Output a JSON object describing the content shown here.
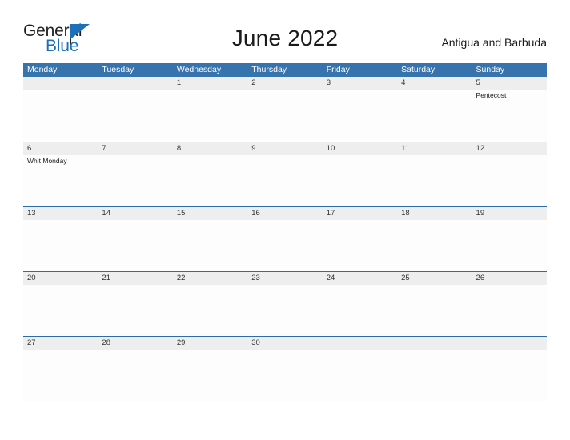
{
  "logo": {
    "word_one": "General",
    "word_two": "Blue",
    "triangle_icon": "triangle-right-icon",
    "accent_color": "#1d70b8"
  },
  "header": {
    "title": "June 2022",
    "region": "Antigua and Barbuda"
  },
  "calendar": {
    "header_color": "#3773ad",
    "band_color": "#eeeeee",
    "weekdays": [
      "Monday",
      "Tuesday",
      "Wednesday",
      "Thursday",
      "Friday",
      "Saturday",
      "Sunday"
    ],
    "weeks": [
      {
        "days": [
          {
            "num": "",
            "events": []
          },
          {
            "num": "",
            "events": []
          },
          {
            "num": "1",
            "events": []
          },
          {
            "num": "2",
            "events": []
          },
          {
            "num": "3",
            "events": []
          },
          {
            "num": "4",
            "events": []
          },
          {
            "num": "5",
            "events": [
              "Pentecost"
            ]
          }
        ]
      },
      {
        "days": [
          {
            "num": "6",
            "events": [
              "Whit Monday"
            ]
          },
          {
            "num": "7",
            "events": []
          },
          {
            "num": "8",
            "events": []
          },
          {
            "num": "9",
            "events": []
          },
          {
            "num": "10",
            "events": []
          },
          {
            "num": "11",
            "events": []
          },
          {
            "num": "12",
            "events": []
          }
        ]
      },
      {
        "days": [
          {
            "num": "13",
            "events": []
          },
          {
            "num": "14",
            "events": []
          },
          {
            "num": "15",
            "events": []
          },
          {
            "num": "16",
            "events": []
          },
          {
            "num": "17",
            "events": []
          },
          {
            "num": "18",
            "events": []
          },
          {
            "num": "19",
            "events": []
          }
        ]
      },
      {
        "days": [
          {
            "num": "20",
            "events": []
          },
          {
            "num": "21",
            "events": []
          },
          {
            "num": "22",
            "events": []
          },
          {
            "num": "23",
            "events": []
          },
          {
            "num": "24",
            "events": []
          },
          {
            "num": "25",
            "events": []
          },
          {
            "num": "26",
            "events": []
          }
        ]
      },
      {
        "days": [
          {
            "num": "27",
            "events": []
          },
          {
            "num": "28",
            "events": []
          },
          {
            "num": "29",
            "events": []
          },
          {
            "num": "30",
            "events": []
          },
          {
            "num": "",
            "events": []
          },
          {
            "num": "",
            "events": []
          },
          {
            "num": "",
            "events": []
          }
        ]
      }
    ]
  }
}
